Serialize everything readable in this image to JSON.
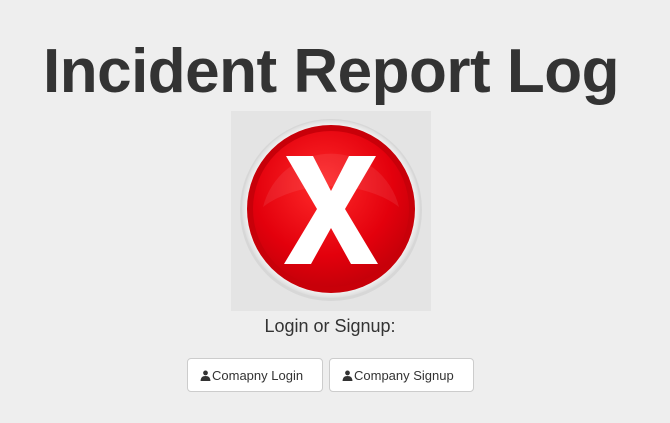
{
  "page": {
    "title": "Incident Report Log",
    "subtitle": "Login or Signup:"
  },
  "logo": {
    "icon": "red-x-circle-icon",
    "colors": {
      "circle": "#e0000b",
      "rim": "#ffffff",
      "mark": "#ffffff"
    }
  },
  "buttons": {
    "login_label": "Comapny Login",
    "signup_label": "Company Signup",
    "icon": "user-icon"
  }
}
